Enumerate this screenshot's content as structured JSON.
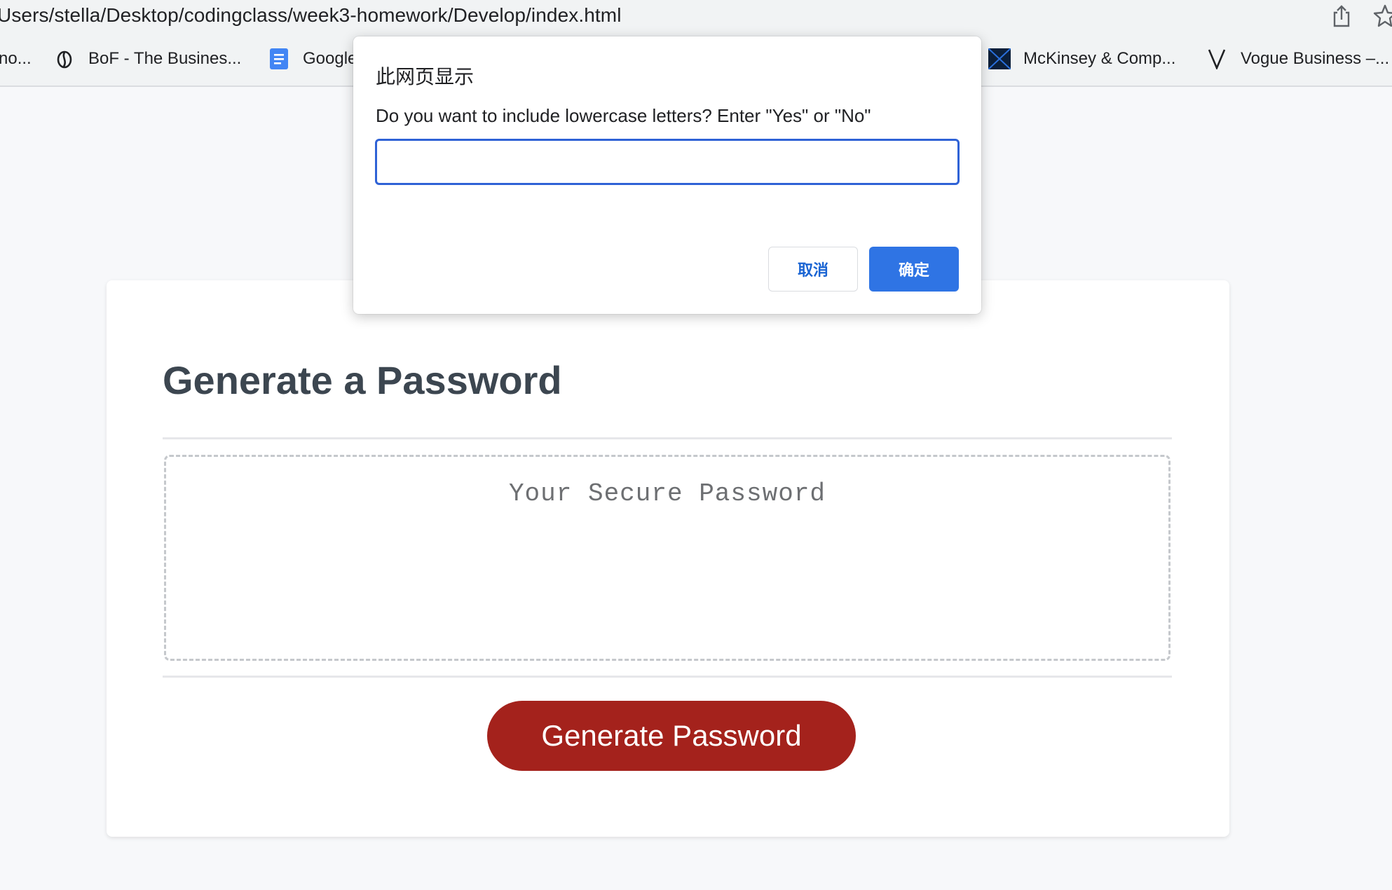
{
  "browser": {
    "url": "Users/stella/Desktop/codingclass/week3-homework/Develop/index.html",
    "bookmarks": [
      {
        "label": "no...",
        "icon": "bookmark-icon"
      },
      {
        "label": "BoF - The Busines...",
        "icon": "bof-logo-icon"
      },
      {
        "label": "Google",
        "icon": "google-docs-icon"
      },
      {
        "label": "McKinsey & Comp...",
        "icon": "mckinsey-logo-icon"
      },
      {
        "label": "Vogue Business –...",
        "icon": "vogue-v-icon"
      }
    ]
  },
  "page": {
    "title": "Generate a Password",
    "password_placeholder": "Your Secure Password",
    "generate_button": "Generate Password",
    "button_color": "#a4221c"
  },
  "dialog": {
    "title": "此网页显示",
    "message": "Do you want to include lowercase letters? Enter \"Yes\" or \"No\"",
    "input_value": "",
    "cancel_label": "取消",
    "ok_label": "确定",
    "accent_color": "#2f74e4"
  }
}
